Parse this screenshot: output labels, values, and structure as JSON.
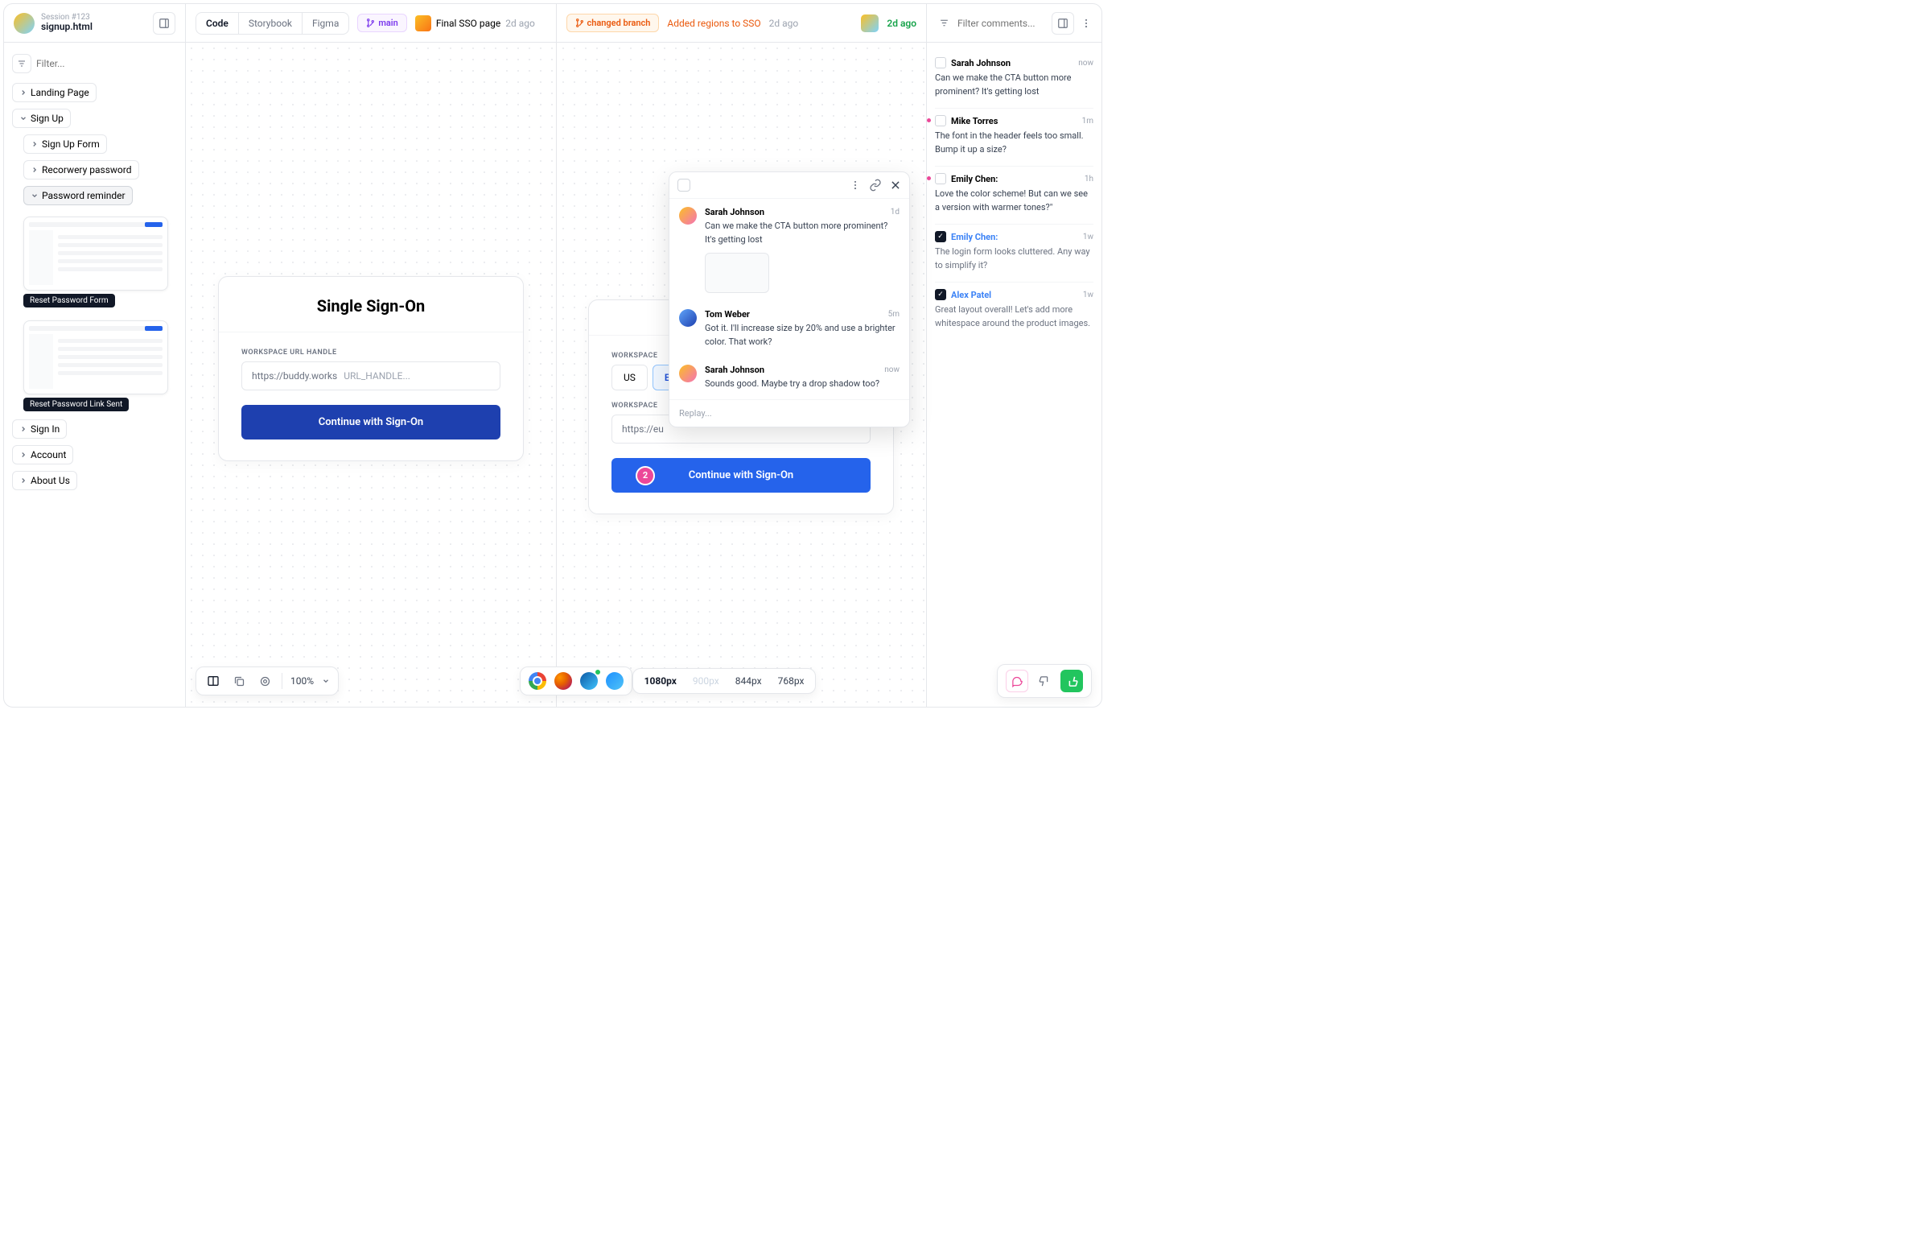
{
  "session": {
    "label": "Session #123",
    "file": "signup.html"
  },
  "tabs": [
    "Code",
    "Storybook",
    "Figma"
  ],
  "tabs_active": 0,
  "branch": {
    "icon": "git-branch",
    "name": "main"
  },
  "left_commit": {
    "title": "Final SSO page",
    "time": "2d ago"
  },
  "right_diff": {
    "pill": "changed branch",
    "text": "Added regions to SSO",
    "time": "2d ago",
    "author_time": "2d ago"
  },
  "filter_placeholder": "Filter...",
  "comments_filter_placeholder": "Filter comments...",
  "tree": {
    "items": [
      "Landing Page",
      "Sign Up",
      "Sign Up Form",
      "Recorwery password",
      "Password reminder",
      "Reset Password Form",
      "Reset Password Link Sent",
      "Sign In",
      "Account",
      "About Us"
    ]
  },
  "sso_left": {
    "title": "Single Sign-On",
    "field_label": "WORKSPACE URL HANDLE",
    "url_prefix": "https://buddy.works",
    "url_placeholder": "URL_HANDLE...",
    "button": "Continue with Sign-On"
  },
  "sso_right": {
    "workspace_label": "WORKSPACE",
    "regions": [
      "US",
      "EU"
    ],
    "region_active": 1,
    "url_value": "https://eu",
    "button": "Continue with Sign-On",
    "pin": "2"
  },
  "popup": {
    "messages": [
      {
        "author": "Sarah Johnson",
        "time": "1d",
        "text": "Can we make the CTA button more prominent? It's getting lost",
        "has_attachment": true
      },
      {
        "author": "Tom Weber",
        "time": "5m",
        "text": "Got it. I'll increase size by 20% and use a brighter color. That work?"
      },
      {
        "author": "Sarah Johnson",
        "time": "now",
        "text": "Sounds good. Maybe try a drop shadow too?"
      }
    ],
    "reply_placeholder": "Replay..."
  },
  "comments": [
    {
      "author": "Sarah Johnson",
      "time": "now",
      "text": "Can we make the CTA button more prominent? It's getting lost",
      "resolved": false,
      "unread": false
    },
    {
      "author": "Mike Torres",
      "time": "1m",
      "text": "The font in the header feels too small. Bump it up a size?",
      "resolved": false,
      "unread": true
    },
    {
      "author": "Emily Chen:",
      "time": "1h",
      "text": "Love the color scheme! But can we see a version with warmer tones?\"",
      "resolved": false,
      "unread": true
    },
    {
      "author": "Emily Chen:",
      "time": "1w",
      "text": "The login form looks cluttered. Any way to simplify it?",
      "resolved": true,
      "unread": false
    },
    {
      "author": "Alex Patel",
      "time": "1w",
      "text": "Great layout overall! Let's add more whitespace around the product images.",
      "resolved": true,
      "unread": false
    }
  ],
  "zoom": "100%",
  "breakpoints": [
    "1080px",
    "900px",
    "844px",
    "768px"
  ],
  "breakpoint_active": 0
}
